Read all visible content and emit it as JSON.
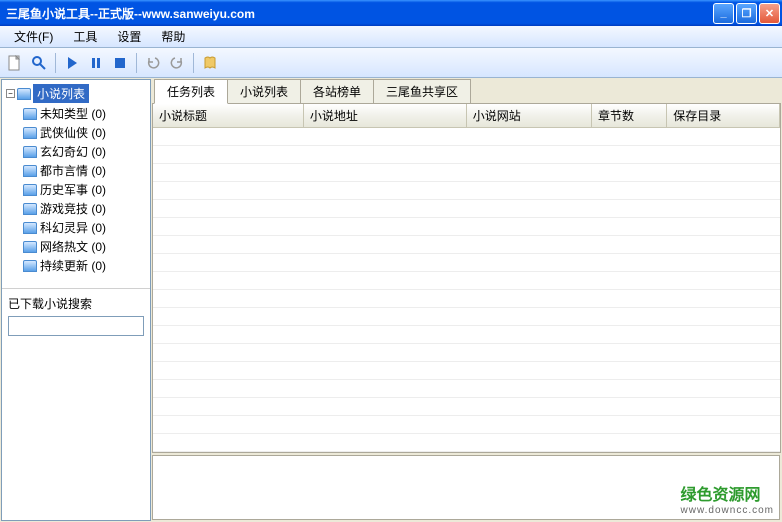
{
  "window": {
    "title": "三尾鱼小说工具--正式版--www.sanweiyu.com"
  },
  "menu": {
    "file": "文件(F)",
    "tools": "工具",
    "settings": "设置",
    "help": "帮助"
  },
  "sidebar": {
    "root_label": "小说列表",
    "items": [
      {
        "label": "未知类型 (0)"
      },
      {
        "label": "武侠仙侠 (0)"
      },
      {
        "label": "玄幻奇幻 (0)"
      },
      {
        "label": "都市言情 (0)"
      },
      {
        "label": "历史军事 (0)"
      },
      {
        "label": "游戏竞技 (0)"
      },
      {
        "label": "科幻灵异 (0)"
      },
      {
        "label": "网络热文 (0)"
      },
      {
        "label": "持续更新 (0)"
      }
    ],
    "search_label": "已下载小说搜索",
    "search_value": ""
  },
  "tabs": {
    "items": [
      {
        "label": "任务列表",
        "active": true
      },
      {
        "label": "小说列表",
        "active": false
      },
      {
        "label": "各站榜单",
        "active": false
      },
      {
        "label": "三尾鱼共享区",
        "active": false
      }
    ]
  },
  "table": {
    "columns": [
      "小说标题",
      "小说地址",
      "小说网站",
      "章节数",
      "保存目录"
    ],
    "rows": []
  },
  "watermark": {
    "name": "绿色资源网",
    "domain": "www.downcc.com"
  }
}
